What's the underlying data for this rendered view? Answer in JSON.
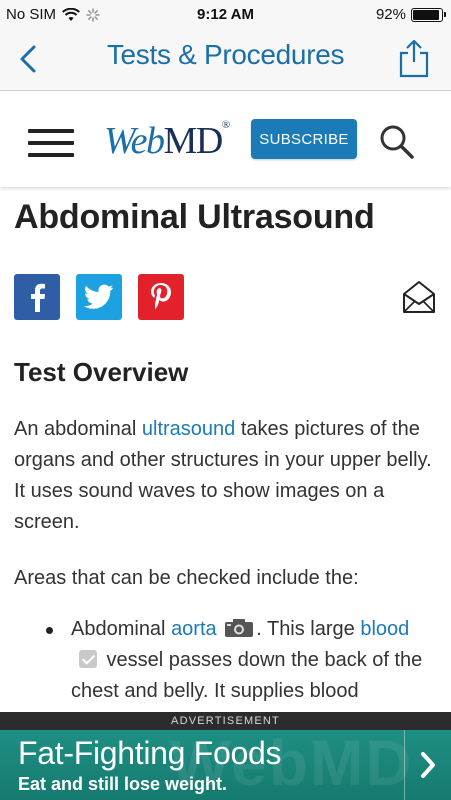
{
  "status_bar": {
    "carrier": "No SIM",
    "time": "9:12 AM",
    "battery_pct": "92%",
    "battery_level": 0.92,
    "icons": [
      "wifi-icon",
      "loading-spinner-icon",
      "battery-icon"
    ]
  },
  "navbar": {
    "title": "Tests & Procedures",
    "back_icon": "chevron-left-icon",
    "share_icon": "share-icon"
  },
  "header": {
    "logo_web": "Web",
    "logo_md": "MD",
    "logo_reg": "®",
    "subscribe_label": "SUBSCRIBE",
    "menu_icon": "hamburger-icon",
    "search_icon": "search-icon"
  },
  "article": {
    "title": "Abdominal Ultrasound",
    "share": {
      "facebook_icon": "facebook-icon",
      "twitter_icon": "twitter-icon",
      "pinterest_icon": "pinterest-icon",
      "email_icon": "envelope-icon"
    },
    "section_title": "Test Overview",
    "para1_prefix": "An abdominal ",
    "para1_link": "ultrasound",
    "para1_suffix": " takes pictures of the organs and other structures in your upper belly. It uses sound waves to show images on a screen.",
    "para2": "Areas that can be checked include the:",
    "bullet1_prefix": "Abdominal ",
    "bullet1_link1": "aorta",
    "bullet1_mid": ". This large ",
    "bullet1_link2": "blood",
    "bullet1_suffix": " vessel passes down the back of the chest and belly. It supplies blood"
  },
  "ad": {
    "label": "ADVERTISEMENT",
    "headline": "Fat-Fighting Foods",
    "subline": "Eat and still lose weight.",
    "watermark": "WebMD",
    "colors": {
      "background": "#1a867a"
    }
  },
  "colors": {
    "accent": "#1b7ab8",
    "facebook": "#2f5da6",
    "twitter": "#1ea1e0",
    "pinterest": "#e2212b"
  }
}
